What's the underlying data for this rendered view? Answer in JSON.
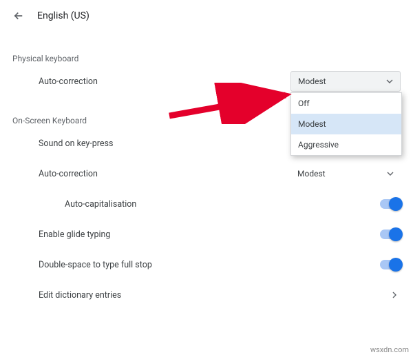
{
  "header": {
    "title": "English (US)"
  },
  "sections": {
    "physical": {
      "label": "Physical keyboard",
      "auto_correction": {
        "label": "Auto-correction",
        "value": "Modest",
        "options": [
          "Off",
          "Modest",
          "Aggressive"
        ],
        "selected_index": 1
      }
    },
    "onscreen": {
      "label": "On-Screen Keyboard",
      "sound": {
        "label": "Sound on key-press"
      },
      "auto_correction": {
        "label": "Auto-correction",
        "value": "Modest"
      },
      "auto_cap": {
        "label": "Auto-capitalisation",
        "on": true
      },
      "glide": {
        "label": "Enable glide typing",
        "on": true
      },
      "double_space": {
        "label": "Double-space to type full stop",
        "on": true
      },
      "dictionary": {
        "label": "Edit dictionary entries"
      }
    }
  },
  "watermark": "wsxdn.com"
}
